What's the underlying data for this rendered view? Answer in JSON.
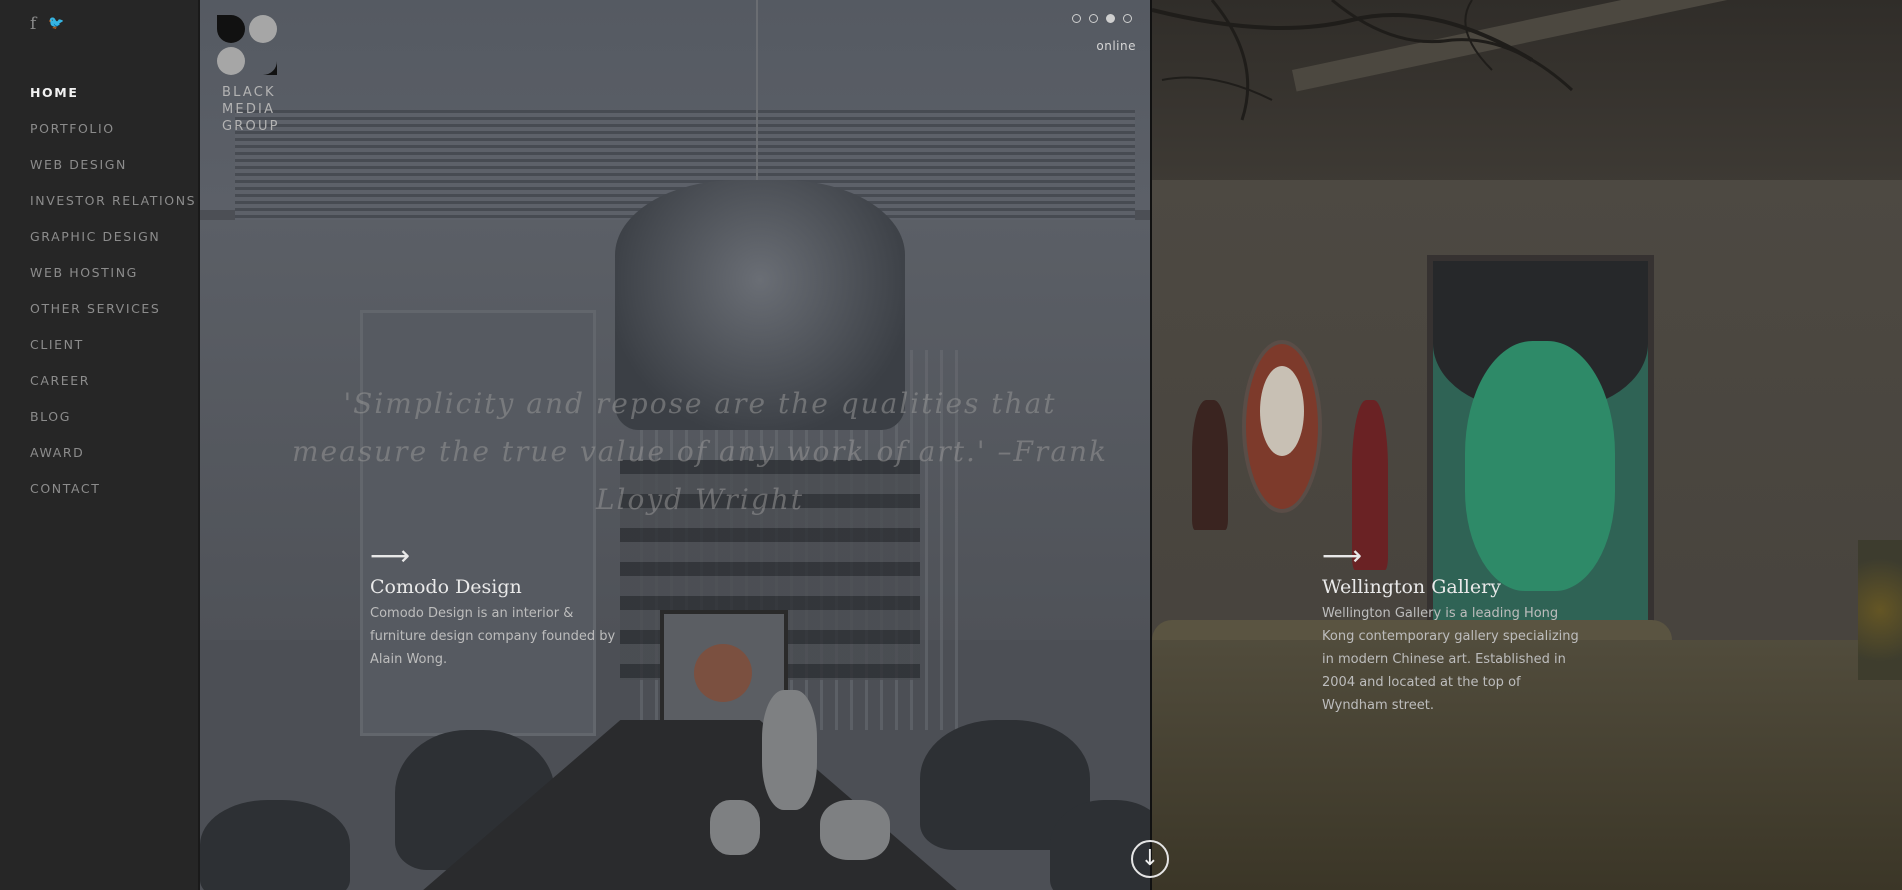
{
  "social": {
    "facebook_glyph": "f",
    "twitter_glyph": "🐦"
  },
  "nav": {
    "items": [
      {
        "label": "HOME",
        "active": true
      },
      {
        "label": "PORTFOLIO"
      },
      {
        "label": "WEB DESIGN"
      },
      {
        "label": "INVESTOR RELATIONS"
      },
      {
        "label": "GRAPHIC DESIGN"
      },
      {
        "label": "WEB HOSTING"
      },
      {
        "label": "OTHER SERVICES"
      },
      {
        "label": "CLIENT"
      },
      {
        "label": "CAREER"
      },
      {
        "label": "BLOG"
      },
      {
        "label": "AWARD"
      },
      {
        "label": "CONTACT"
      }
    ]
  },
  "logo": {
    "line1": "BLACK",
    "line2": "MEDIA",
    "line3": "GROUP"
  },
  "slider": {
    "count": 4,
    "active_index": 2,
    "status": "online"
  },
  "quote": "'Simplicity and repose are the qualities that measure the true value of any work of art.' –Frank Lloyd Wright",
  "projects": [
    {
      "arrow": "⟶",
      "title": "Comodo Design",
      "description": "Comodo Design is an interior & furniture design company founded by Alain Wong."
    },
    {
      "arrow": "⟶",
      "title": "Wellington Gallery",
      "description": "Wellington Gallery is a leading Hong Kong contemporary gallery specializing in modern Chinese art. Established in 2004 and located at the top of Wyndham street."
    }
  ],
  "scroll_down": {
    "glyph": "↓"
  },
  "colors": {
    "sidebar": "#262626",
    "active_nav": "#f2f2f2",
    "nav": "#8c8c8c"
  }
}
